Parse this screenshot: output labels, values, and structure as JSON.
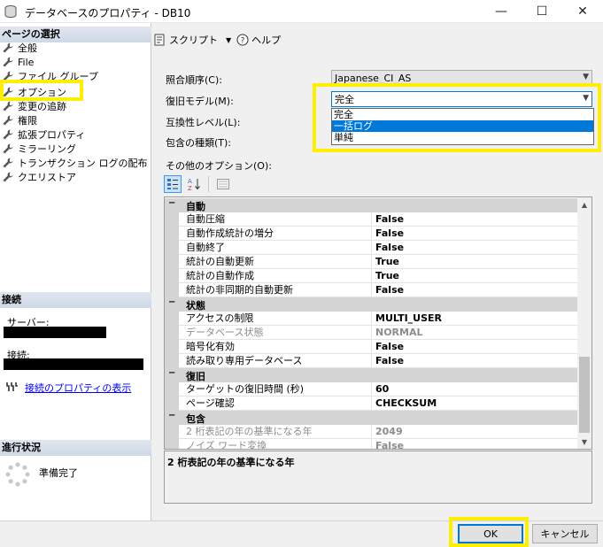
{
  "window": {
    "title": "データベースのプロパティ - DB10",
    "minimize_glyph": "—",
    "maximize_glyph": "☐",
    "close_glyph": "✕"
  },
  "left_pane": {
    "page_select_header": "ページの選択",
    "pages": [
      "全般",
      "File",
      "ファイル グループ",
      "オプション",
      "変更の追跡",
      "権限",
      "拡張プロパティ",
      "ミラーリング",
      "トランザクション ログの配布",
      "クエリストア"
    ],
    "connection_header": "接続",
    "server_label": "サーバー:",
    "connection_label": "接続:",
    "view_connection_properties": "接続のプロパティの表示",
    "progress_header": "進行状況",
    "progress_status": "準備完了"
  },
  "toolbar": {
    "script_label": "スクリプト",
    "help_label": "ヘルプ"
  },
  "form": {
    "collation_label": "照合順序(C):",
    "collation_value": "Japanese_CI_AS",
    "recovery_model_label": "復旧モデル(M):",
    "recovery_model_value": "完全",
    "recovery_model_options": [
      "完全",
      "一括ログ",
      "単純"
    ],
    "recovery_model_highlighted": "一括ログ",
    "compat_level_label": "互換性レベル(L):",
    "containment_label": "包含の種類(T):",
    "other_options_label": "その他のオプション(O):"
  },
  "grid": {
    "categories": [
      {
        "name": "自動",
        "sign": "−",
        "props": [
          {
            "name": "自動圧縮",
            "value": "False"
          },
          {
            "name": "自動作成統計の増分",
            "value": "False"
          },
          {
            "name": "自動終了",
            "value": "False"
          },
          {
            "name": "統計の自動更新",
            "value": "True"
          },
          {
            "name": "統計の自動作成",
            "value": "True"
          },
          {
            "name": "統計の非同期的自動更新",
            "value": "False"
          }
        ]
      },
      {
        "name": "状態",
        "sign": "−",
        "props": [
          {
            "name": "アクセスの制限",
            "value": "MULTI_USER"
          },
          {
            "name": "データベース状態",
            "value": "NORMAL",
            "disabled": true
          },
          {
            "name": "暗号化有効",
            "value": "False"
          },
          {
            "name": "読み取り専用データベース",
            "value": "False"
          }
        ]
      },
      {
        "name": "復旧",
        "sign": "−",
        "props": [
          {
            "name": "ターゲットの復旧時間 (秒)",
            "value": "60"
          },
          {
            "name": "ページ確認",
            "value": "CHECKSUM"
          }
        ]
      },
      {
        "name": "包含",
        "sign": "−",
        "props": [
          {
            "name": "2 桁表記の年の基準になる年",
            "value": "2049",
            "disabled": true
          },
          {
            "name": "ノイズ ワード変換",
            "value": "False",
            "disabled": true
          }
        ]
      }
    ]
  },
  "description": "2 桁表記の年の基準になる年",
  "buttons": {
    "ok": "OK",
    "cancel": "キャンセル"
  },
  "colors": {
    "highlight": "#ffee00",
    "selection": "#0078d7",
    "link": "#0000ee"
  }
}
